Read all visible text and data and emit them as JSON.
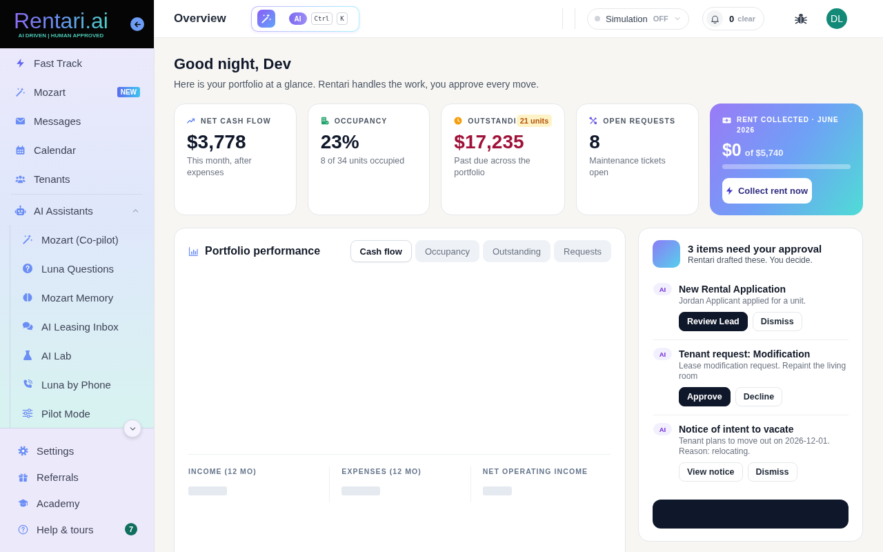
{
  "sidebar": {
    "logo": {
      "name": "Rentari.ai",
      "tagline": "AI DRIVEN | HUMAN APPROVED"
    },
    "items": [
      {
        "label": "Fast Track",
        "selected": false
      },
      {
        "label": "Mozart",
        "selected": false,
        "badge": "NEW"
      },
      {
        "label": "Messages",
        "selected": false
      },
      {
        "label": "Calendar",
        "selected": false
      },
      {
        "label": "Tenants",
        "selected": false
      }
    ],
    "assistants": {
      "label": "AI Assistants",
      "expanded": true,
      "children": [
        {
          "label": "Mozart (Co-pilot)",
          "selected": false
        },
        {
          "label": "Luna Questions",
          "selected": false
        },
        {
          "label": "Mozart Memory",
          "selected": false
        },
        {
          "label": "AI Leasing Inbox",
          "selected": false
        },
        {
          "label": "AI Lab",
          "selected": false
        },
        {
          "label": "Luna by Phone",
          "selected": false
        },
        {
          "label": "Pilot Mode",
          "selected": false
        }
      ]
    },
    "footer_items": [
      {
        "label": "Settings",
        "selected": false
      },
      {
        "label": "Referrals",
        "selected": false
      },
      {
        "label": "Academy",
        "selected": false
      },
      {
        "label": "Help & tours",
        "selected": false,
        "badge": "7"
      }
    ]
  },
  "header": {
    "title": "Overview",
    "command": {
      "ai_label": "AI",
      "keys": [
        "Ctrl",
        "K"
      ]
    },
    "simulation": {
      "label": "Simulation",
      "status": "OFF",
      "on": false
    },
    "notifications": {
      "count": "0",
      "action": "clear"
    },
    "avatar": {
      "initials": "DL"
    }
  },
  "greeting": {
    "title": "Good night, Dev",
    "subtitle": "Here is your portfolio at a glance. Rentari handles the work, you approve every move."
  },
  "stats": [
    {
      "label": "NET CASH FLOW",
      "value": "$3,778",
      "note": "This month, after expenses",
      "alert": false
    },
    {
      "label": "OCCUPANCY",
      "value": "23%",
      "note": "8 of 34 units occupied",
      "alert": false
    },
    {
      "label": "OUTSTANDI",
      "badge": "21 units",
      "value": "$17,235",
      "note": "Past due across the portfolio",
      "alert": true
    },
    {
      "label": "OPEN REQUESTS",
      "value": "8",
      "note": "Maintenance tickets open",
      "alert": false
    }
  ],
  "rent": {
    "label": "RENT COLLECTED · JUNE 2026",
    "amount": "$0",
    "total": "of $5,740",
    "level": 0,
    "button": "Collect rent now"
  },
  "performance": {
    "title": "Portfolio performance",
    "tabs": [
      {
        "label": "Cash flow",
        "selected": true
      },
      {
        "label": "Occupancy",
        "selected": false
      },
      {
        "label": "Outstanding",
        "selected": false
      },
      {
        "label": "Requests",
        "selected": false
      }
    ],
    "summary": [
      {
        "label": "INCOME (12 MO)",
        "loading": true
      },
      {
        "label": "EXPENSES (12 MO)",
        "loading": true
      },
      {
        "label": "NET OPERATING INCOME",
        "loading": true
      }
    ]
  },
  "approvals": {
    "title": "3 items need your approval",
    "subtitle": "Rentari drafted these. You decide.",
    "items": [
      {
        "tag": "AI",
        "title": "New Rental Application",
        "description": "Jordan Applicant applied for a unit.",
        "actions": [
          {
            "label": "Review Lead",
            "kind": "primary"
          },
          {
            "label": "Dismiss",
            "kind": "secondary"
          }
        ]
      },
      {
        "tag": "AI",
        "title": "Tenant request: Modification",
        "description": "Lease modification request. Repaint the living room",
        "actions": [
          {
            "label": "Approve",
            "kind": "primary"
          },
          {
            "label": "Decline",
            "kind": "secondary"
          }
        ]
      },
      {
        "tag": "AI",
        "title": "Notice of intent to vacate",
        "description": "Tenant plans to move out on 2026-12-01. Reason: relocating.",
        "actions": [
          {
            "label": "View notice",
            "kind": "secondary"
          },
          {
            "label": "Dismiss",
            "kind": "secondary"
          }
        ]
      }
    ]
  }
}
